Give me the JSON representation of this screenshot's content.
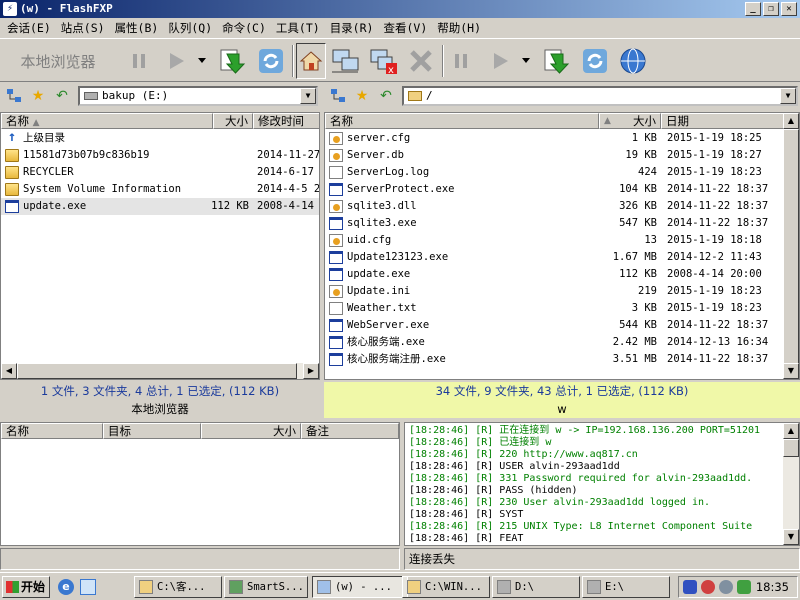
{
  "window": {
    "title": "(w) - FlashFXP",
    "min": "_",
    "max": "❐",
    "close": "✕"
  },
  "menu": [
    "会话(E)",
    "站点(S)",
    "属性(B)",
    "队列(Q)",
    "命令(C)",
    "工具(T)",
    "目录(R)",
    "查看(V)",
    "帮助(H)"
  ],
  "toolbar": {
    "local_browser": "本地浏览器"
  },
  "left": {
    "path": "bakup  (E:)",
    "columns": {
      "name": "名称",
      "size": "大小",
      "modified": "修改时间"
    },
    "rows": [
      {
        "name": "上级目录",
        "size": "",
        "date": "",
        "icon": "up-icon"
      },
      {
        "name": "11581d73b07b9c836b19",
        "size": "",
        "date": "2014-11-27",
        "icon": "folder-icon"
      },
      {
        "name": "RECYCLER",
        "size": "",
        "date": "2014-6-17",
        "icon": "folder-icon"
      },
      {
        "name": "System Volume Information",
        "size": "",
        "date": "2014-4-5 2",
        "icon": "folder-icon"
      },
      {
        "name": "update.exe",
        "size": "112 KB",
        "date": "2008-4-14",
        "icon": "exe-icon"
      }
    ],
    "status1": "1 文件, 3 文件夹, 4 总计, 1 已选定, (112 KB)",
    "status2": "本地浏览器"
  },
  "right": {
    "path": "/",
    "columns": {
      "name": "名称",
      "size": "大小",
      "date": "日期"
    },
    "rows": [
      {
        "name": "server.cfg",
        "size": "1 KB",
        "date": "2015-1-19 18:25",
        "icon": "cfg-icon"
      },
      {
        "name": "Server.db",
        "size": "19 KB",
        "date": "2015-1-19 18:27",
        "icon": "cfg-icon"
      },
      {
        "name": "ServerLog.log",
        "size": "424",
        "date": "2015-1-19 18:23",
        "icon": "doc-icon"
      },
      {
        "name": "ServerProtect.exe",
        "size": "104 KB",
        "date": "2014-11-22 18:37",
        "icon": "exe-icon"
      },
      {
        "name": "sqlite3.dll",
        "size": "326 KB",
        "date": "2014-11-22 18:37",
        "icon": "cfg-icon"
      },
      {
        "name": "sqlite3.exe",
        "size": "547 KB",
        "date": "2014-11-22 18:37",
        "icon": "exe-icon"
      },
      {
        "name": "uid.cfg",
        "size": "13",
        "date": "2015-1-19 18:18",
        "icon": "cfg-icon"
      },
      {
        "name": "Update123123.exe",
        "size": "1.67 MB",
        "date": "2014-12-2 11:43",
        "icon": "exe-icon"
      },
      {
        "name": "update.exe",
        "size": "112 KB",
        "date": "2008-4-14 20:00",
        "icon": "exe-icon"
      },
      {
        "name": "Update.ini",
        "size": "219",
        "date": "2015-1-19 18:23",
        "icon": "cfg-icon"
      },
      {
        "name": "Weather.txt",
        "size": "3 KB",
        "date": "2015-1-19 18:23",
        "icon": "doc-icon"
      },
      {
        "name": "WebServer.exe",
        "size": "544 KB",
        "date": "2014-11-22 18:37",
        "icon": "exe-icon"
      },
      {
        "name": "核心服务端.exe",
        "size": "2.42 MB",
        "date": "2014-12-13 16:34",
        "icon": "exe-icon"
      },
      {
        "name": "核心服务端注册.exe",
        "size": "3.51 MB",
        "date": "2014-11-22 18:37",
        "icon": "exe-icon"
      }
    ],
    "status1": "34 文件, 9 文件夹, 43 总计, 1 已选定, (112 KB)",
    "status2": "w"
  },
  "queue": {
    "columns": {
      "name": "名称",
      "target": "目标",
      "size": "大小",
      "note": "备注"
    }
  },
  "log": [
    {
      "text": "[18:28:46] [R] 正在连接到 w -> IP=192.168.136.200 PORT=51201",
      "color": "#008000"
    },
    {
      "text": "[18:28:46] [R] 已连接到 w",
      "color": "#008000"
    },
    {
      "text": "[18:28:46] [R] 220 http://www.aq817.cn",
      "color": "#008000"
    },
    {
      "text": "[18:28:46] [R] USER alvin-293aad1dd",
      "color": "#000000"
    },
    {
      "text": "[18:28:46] [R] 331 Password required for alvin-293aad1dd.",
      "color": "#008000"
    },
    {
      "text": "[18:28:46] [R] PASS (hidden)",
      "color": "#000000"
    },
    {
      "text": "[18:28:46] [R] 230 User alvin-293aad1dd logged in.",
      "color": "#008000"
    },
    {
      "text": "[18:28:46] [R] SYST",
      "color": "#000000"
    },
    {
      "text": "[18:28:46] [R] 215 UNIX Type: L8 Internet Component Suite",
      "color": "#008000"
    },
    {
      "text": "[18:28:46] [R] FEAT",
      "color": "#000000"
    }
  ],
  "bottom_status_right": "连接丢失",
  "taskbar": {
    "start": "开始",
    "tasks": [
      "C:\\客...",
      "SmartS...",
      "(w) - ...",
      "C:\\WIN...",
      "D:\\",
      "E:\\"
    ],
    "clock": "18:35"
  },
  "colors": {
    "right_status_bg": "#f0f8a8",
    "selected_row": "#e4e4e4",
    "log_green": "#008000",
    "title_gradient_start": "#0a246a"
  }
}
